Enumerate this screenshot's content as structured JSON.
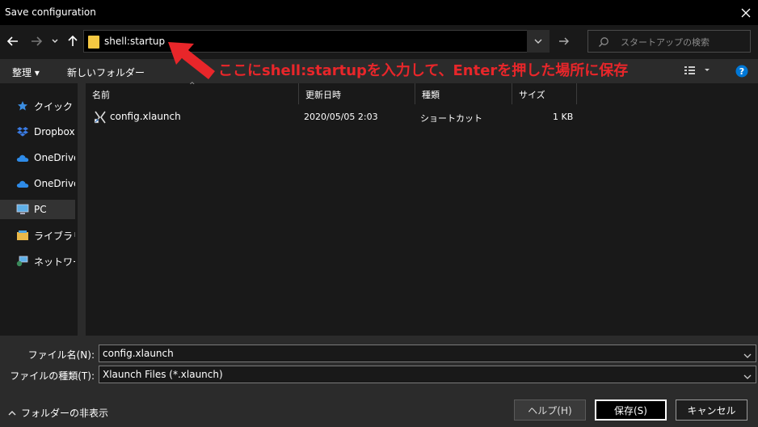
{
  "window": {
    "title": "Save configuration"
  },
  "nav": {
    "address": "shell:startup",
    "search_placeholder": "スタートアップの検索"
  },
  "toolbar": {
    "organize": "整理 ▾",
    "new_folder": "新しいフォルダー"
  },
  "annotation": "ここにshell:startupを入力して、Enterを押した場所に保存",
  "sidebar": {
    "items": [
      {
        "label": "クイック アクセス",
        "icon": "star-icon"
      },
      {
        "label": "Dropbox",
        "icon": "dropbox-icon"
      },
      {
        "label": "OneDrive",
        "icon": "cloud-icon"
      },
      {
        "label": "OneDrive",
        "icon": "cloud-icon"
      },
      {
        "label": "PC",
        "icon": "pc-icon"
      },
      {
        "label": "ライブラリ",
        "icon": "library-icon"
      },
      {
        "label": "ネットワーク",
        "icon": "network-icon"
      }
    ]
  },
  "columns": {
    "name": "名前",
    "modified": "更新日時",
    "type": "種類",
    "size": "サイズ"
  },
  "files": [
    {
      "name": "config.xlaunch",
      "modified": "2020/05/05 2:03",
      "type": "ショートカット",
      "size": "1 KB"
    }
  ],
  "form": {
    "filename_label": "ファイル名(N):",
    "filename_value": "config.xlaunch",
    "filetype_label": "ファイルの種類(T):",
    "filetype_value": "Xlaunch Files (*.xlaunch)"
  },
  "footer": {
    "hide_folders": "フォルダーの非表示",
    "help": "ヘルプ(H)",
    "save": "保存(S)",
    "cancel": "キャンセル"
  },
  "colors": {
    "annotation": "#e8262a",
    "folder": "#f5c842",
    "accent": "#0078d7"
  }
}
